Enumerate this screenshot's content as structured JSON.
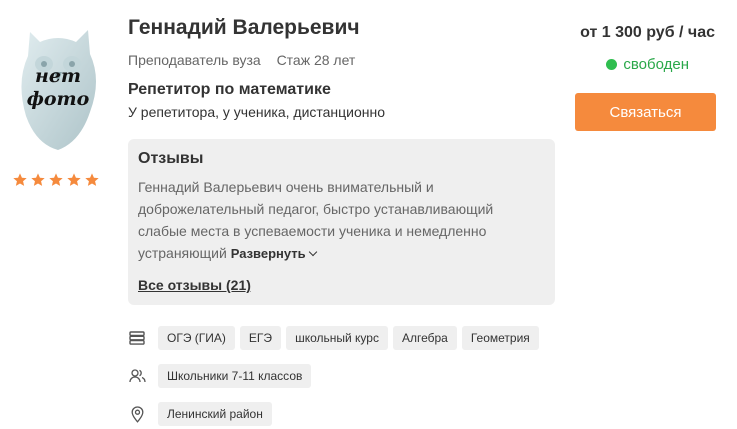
{
  "tutor": {
    "name": "Геннадий Валерьевич",
    "position": "Преподаватель вуза",
    "experience": "Стаж 28 лет",
    "subject": "Репетитор по математике",
    "lesson_formats": "У репетитора, у ученика, дистанционно",
    "photo_placeholder_line1": "нет",
    "photo_placeholder_line2": "фото",
    "rating_stars": 5
  },
  "pricing": {
    "price": "от 1 300 руб / час",
    "status": "свободен",
    "contact_button": "Связаться"
  },
  "reviews": {
    "title": "Отзывы",
    "text": "Геннадий Валерьевич очень внимательный и доброжелательный педагог, быстро устанавливающий слабые места в успеваемости ученика и немедленно устраняющий",
    "expand_label": "Развернуть",
    "all_reviews_label": "Все отзывы (21)"
  },
  "subjects": {
    "icon": "books-icon",
    "tags": [
      "ОГЭ (ГИА)",
      "ЕГЭ",
      "школьный курс",
      "Алгебра",
      "Геометрия"
    ]
  },
  "students": {
    "icon": "users-icon",
    "tags": [
      "Школьники 7-11 классов"
    ]
  },
  "district": {
    "icon": "location-pin-icon",
    "tags": [
      "Ленинский район"
    ]
  },
  "colors": {
    "accent": "#f58a3d",
    "status_green": "#2fbe4f",
    "panel_bg": "#efefef"
  }
}
